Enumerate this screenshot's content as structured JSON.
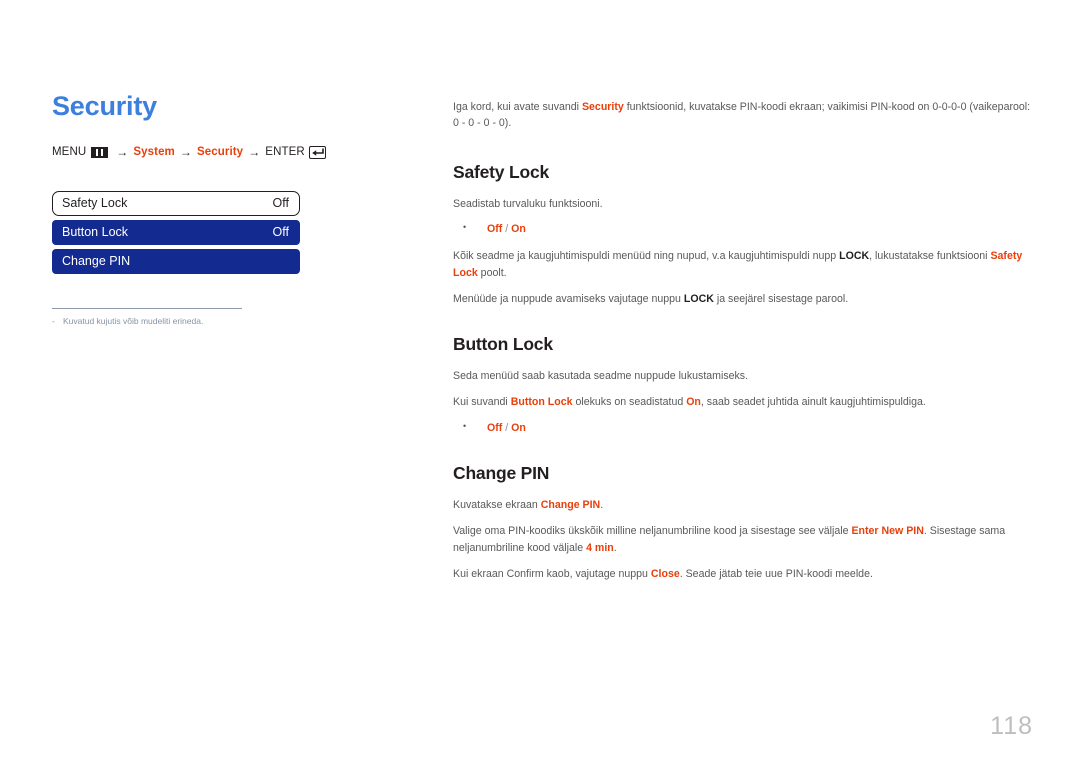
{
  "document": {
    "page_number": "118",
    "title": "Security"
  },
  "menu_path": {
    "menu_label": "MENU",
    "menu_icon": "menu-bars-icon",
    "arrow": "→",
    "segments": [
      {
        "text": "System",
        "color": "#e8400c"
      },
      {
        "text": "Security",
        "color": "#e8400c"
      }
    ],
    "enter_label": "ENTER",
    "enter_icon": "enter-return-icon"
  },
  "osd": {
    "rows": [
      {
        "label": "Safety Lock",
        "value": "Off",
        "style": "selected"
      },
      {
        "label": "Button Lock",
        "value": "Off",
        "style": "bar"
      },
      {
        "label": "Change PIN",
        "value": "",
        "style": "bar"
      }
    ]
  },
  "footnote": {
    "dash": "-",
    "text": "Kuvatud kujutis võib mudeliti erineda."
  },
  "intro": {
    "part1": "Iga kord, kui avate suvandi ",
    "kw1": "Security",
    "part2": " funktsioonid, kuvatakse PIN-koodi ekraan; vaikimisi PIN-kood on 0-0-0-0 (vaikeparool: 0 - 0 - 0 - 0)."
  },
  "sections": [
    {
      "title": "Safety Lock",
      "p1": "Seadistab turvaluku funktsiooni.",
      "options": {
        "off": "Off",
        "sep": " / ",
        "on": "On"
      },
      "p2_part1": "Kõik seadme ja kaugjuhtimispuldi menüüd ning nupud, v.a kaugjuhtimispuldi nupp ",
      "p2_kw1": "LOCK",
      "p2_part2": ", lukustatakse funktsiooni ",
      "p2_kw2": "Safety Lock",
      "p2_part3": " poolt.",
      "p3_part1": "Menüüde ja nuppude avamiseks vajutage nuppu ",
      "p3_kw1": "LOCK",
      "p3_part2": " ja seejärel sisestage parool."
    },
    {
      "title": "Button Lock",
      "p1": "Seda menüüd saab kasutada seadme nuppude lukustamiseks.",
      "p2_part1": "Kui suvandi ",
      "p2_kw1": "Button Lock",
      "p2_part2": " olekuks on seadistatud ",
      "p2_kw2": "On",
      "p2_part3": ", saab seadet juhtida ainult kaugjuhtimispuldiga.",
      "options": {
        "off": "Off",
        "sep": " / ",
        "on": "On"
      }
    },
    {
      "title": "Change PIN",
      "p1_part1": "Kuvatakse ekraan ",
      "p1_kw1": "Change PIN",
      "p1_part2": ".",
      "p2_part1": "Valige oma PIN-koodiks ükskõik milline neljanumbriline kood ja sisestage see väljale ",
      "p2_kw1": "Enter New PIN",
      "p2_part2": ". Sisestage sama neljanumbriline kood väljale ",
      "p2_kw2": "4 min",
      "p2_part3": ".",
      "p3_part1": "Kui ekraan Confirm kaob, vajutage nuppu ",
      "p3_kw1": "Close",
      "p3_part2": ". Seade jätab teie uue PIN-koodi meelde."
    }
  ],
  "colors": {
    "title_blue": "#3d7fdd",
    "keyword_red": "#e8400c",
    "osd_bar_blue": "#132a91",
    "body_gray": "#58595b",
    "page_number_gray": "#bcbec0"
  }
}
